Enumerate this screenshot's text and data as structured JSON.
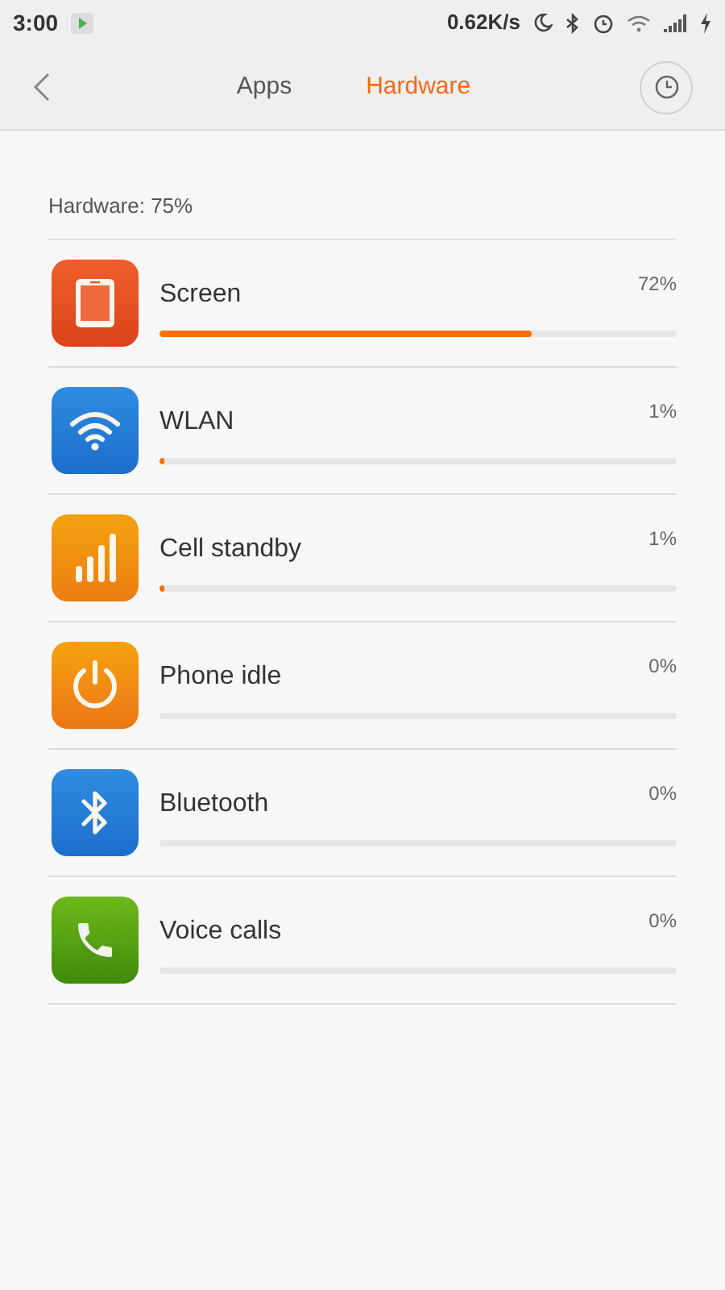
{
  "status_bar": {
    "time": "3:00",
    "speed": "0.62K/s"
  },
  "tabs": [
    {
      "label": "Apps",
      "selected": false
    },
    {
      "label": "Hardware",
      "selected": true
    }
  ],
  "summary": "Hardware: 75%",
  "items": [
    {
      "kind": "screen",
      "name": "Screen",
      "reading": "72%",
      "level": 0.72
    },
    {
      "kind": "wlan",
      "name": "WLAN",
      "reading": "1%",
      "level": 0.01
    },
    {
      "kind": "cell",
      "name": "Cell standby",
      "reading": "1%",
      "level": 0.01
    },
    {
      "kind": "idle",
      "name": "Phone idle",
      "reading": "0%",
      "level": 0
    },
    {
      "kind": "bluetooth",
      "name": "Bluetooth",
      "reading": "0%",
      "level": 0
    },
    {
      "kind": "call",
      "name": "Voice calls",
      "reading": "0%",
      "level": 0
    }
  ]
}
